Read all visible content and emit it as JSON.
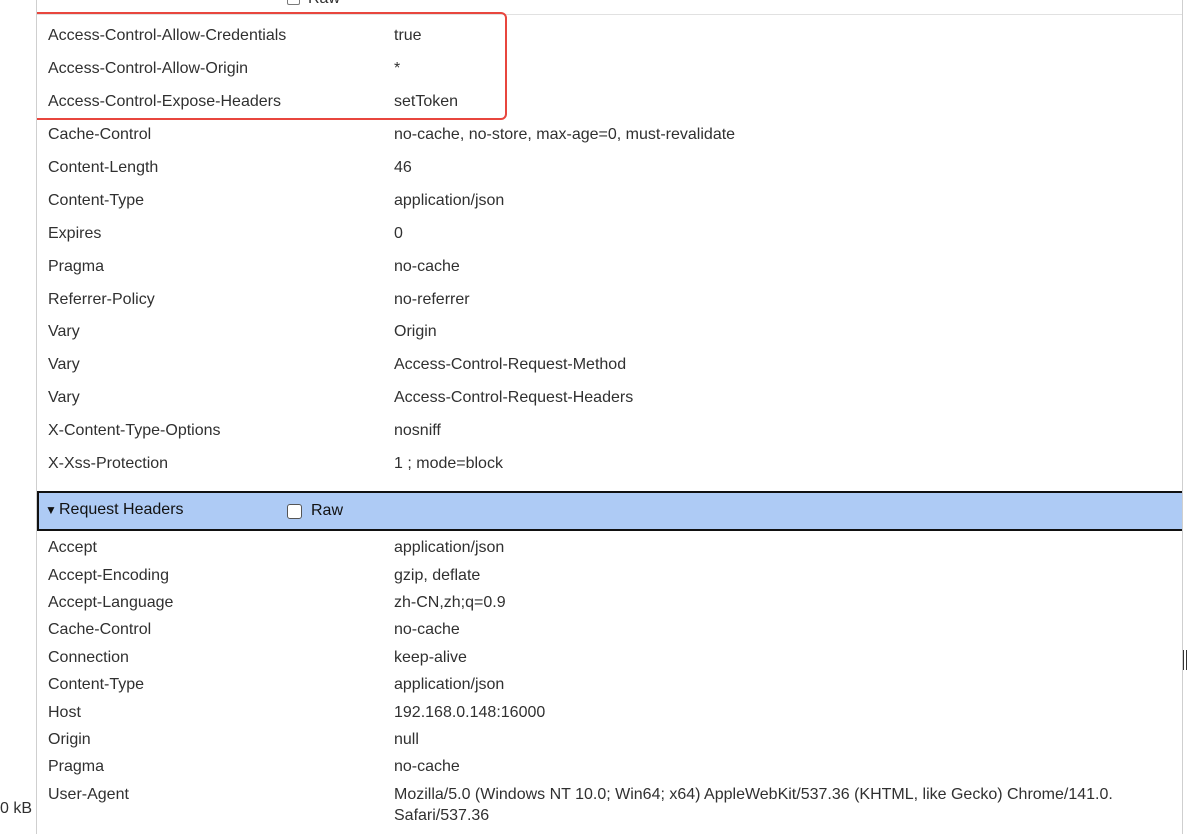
{
  "status_bar": {
    "size_text": "0 kB"
  },
  "response_headers_top_raw_label": "Raw",
  "response_headers": [
    {
      "name": "Access-Control-Allow-Credentials",
      "value": "true"
    },
    {
      "name": "Access-Control-Allow-Origin",
      "value": "*"
    },
    {
      "name": "Access-Control-Expose-Headers",
      "value": "setToken"
    },
    {
      "name": "Cache-Control",
      "value": "no-cache, no-store, max-age=0, must-revalidate"
    },
    {
      "name": "Content-Length",
      "value": "46"
    },
    {
      "name": "Content-Type",
      "value": "application/json"
    },
    {
      "name": "Expires",
      "value": "0"
    },
    {
      "name": "Pragma",
      "value": "no-cache"
    },
    {
      "name": "Referrer-Policy",
      "value": "no-referrer"
    },
    {
      "name": "Vary",
      "value": "Origin"
    },
    {
      "name": "Vary",
      "value": "Access-Control-Request-Method"
    },
    {
      "name": "Vary",
      "value": "Access-Control-Request-Headers"
    },
    {
      "name": "X-Content-Type-Options",
      "value": "nosniff"
    },
    {
      "name": "X-Xss-Protection",
      "value": "1 ; mode=block"
    }
  ],
  "request_section": {
    "arrow": "▼",
    "title": "Request Headers",
    "raw_label": "Raw"
  },
  "request_headers": [
    {
      "name": "Accept",
      "value": "application/json"
    },
    {
      "name": "Accept-Encoding",
      "value": "gzip, deflate"
    },
    {
      "name": "Accept-Language",
      "value": "zh-CN,zh;q=0.9"
    },
    {
      "name": "Cache-Control",
      "value": "no-cache"
    },
    {
      "name": "Connection",
      "value": "keep-alive"
    },
    {
      "name": "Content-Type",
      "value": "application/json"
    },
    {
      "name": "Host",
      "value": "192.168.0.148:16000"
    },
    {
      "name": "Origin",
      "value": "null"
    },
    {
      "name": "Pragma",
      "value": "no-cache"
    },
    {
      "name": "User-Agent",
      "value": "Mozilla/5.0 (Windows NT 10.0; Win64; x64) AppleWebKit/537.36 (KHTML, like Gecko) Chrome/141.0.",
      "value_line2": "Safari/537.36"
    }
  ],
  "colors": {
    "highlight_border": "#e8463e",
    "section_header_bg": "#aecbf5"
  }
}
